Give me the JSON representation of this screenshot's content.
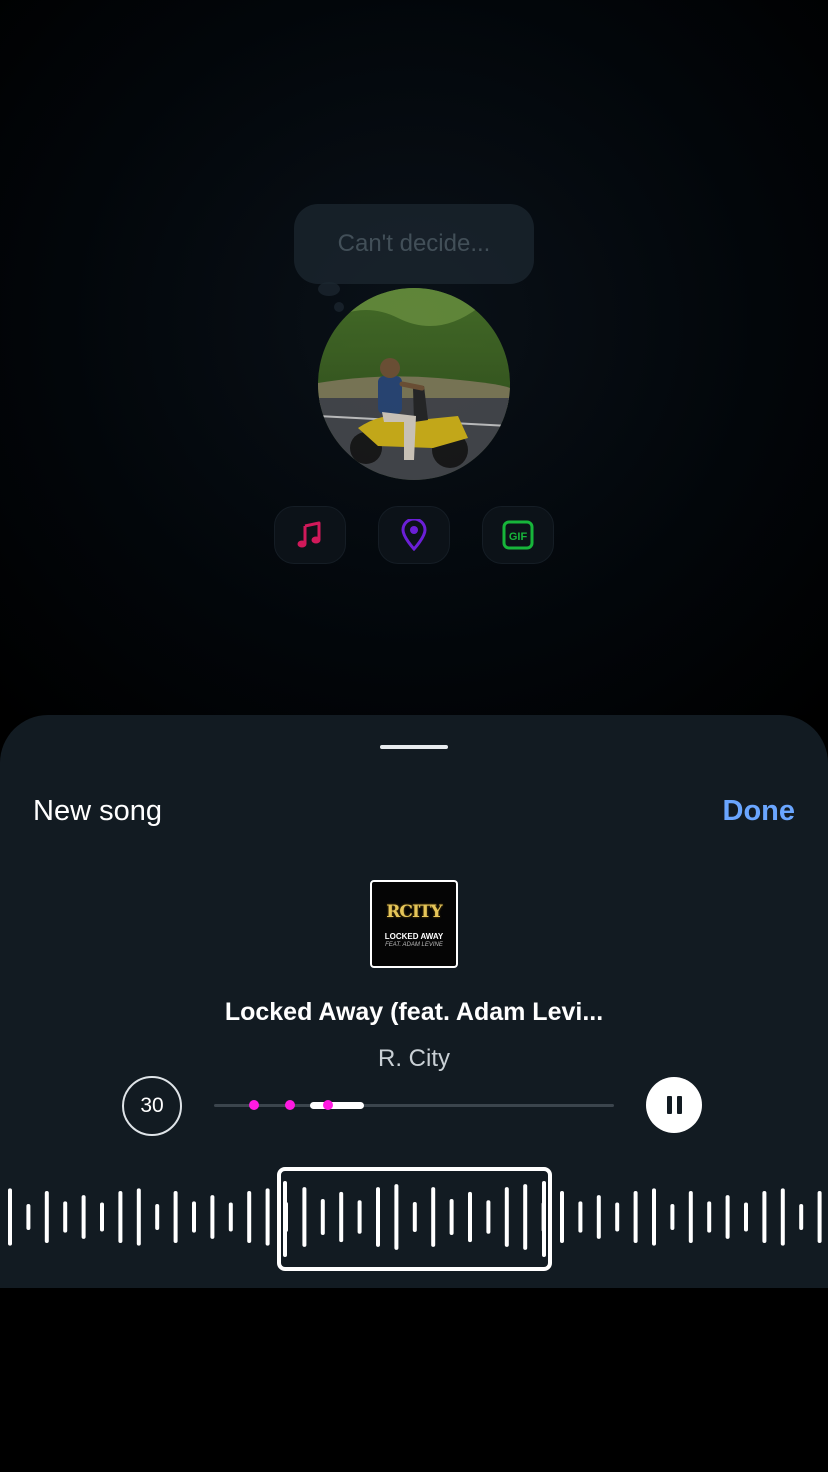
{
  "note": {
    "placeholder": "Can't decide..."
  },
  "note_options": [
    {
      "icon": "music-note-icon",
      "color": "#d1195a"
    },
    {
      "icon": "location-pin-icon",
      "color": "#6b1fd6"
    },
    {
      "icon": "gif-icon",
      "label": "GIF",
      "color": "#17b53a"
    }
  ],
  "sheet": {
    "title": "New song",
    "done_label": "Done"
  },
  "song": {
    "album_art": {
      "logo_text": "RCITY",
      "cover_title": "LOCKED AWAY",
      "cover_subtitle": "FEAT. ADAM LEVINE"
    },
    "title": "Locked Away (feat. Adam Levi...",
    "artist": "R. City"
  },
  "player": {
    "duration_label": "30",
    "selection_start_fraction": 0.24,
    "selection_end_fraction": 0.375,
    "marker_fractions": [
      0.1,
      0.19,
      0.285
    ],
    "state": "playing",
    "accent_color": "#ff1ae1"
  },
  "colors": {
    "accent_link": "#6aa6ff",
    "sheet_bg": "#121b22"
  }
}
